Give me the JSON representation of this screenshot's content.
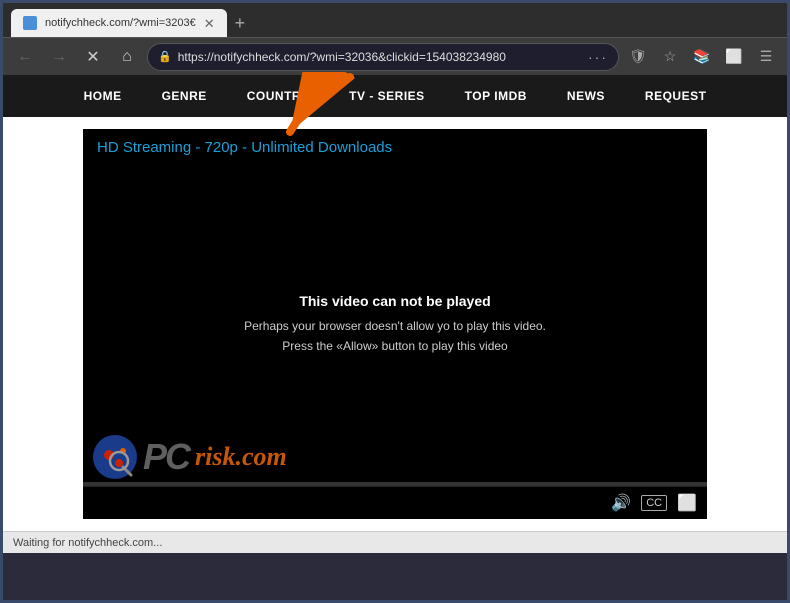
{
  "browser": {
    "tab": {
      "title": "notifychheck.com/?wmi=3203€",
      "favicon_color": "#4a90d9"
    },
    "address": "https://notifychheck.com/?wmi=32036&clickid=1540382349804",
    "address_display": "https://notifychheck.com/?wmi=32036&clickid=154038234980",
    "new_tab_label": "+",
    "back_label": "←",
    "forward_label": "→",
    "refresh_label": "✕",
    "home_label": "⌂"
  },
  "site_nav": {
    "items": [
      {
        "label": "HOME"
      },
      {
        "label": "GENRE"
      },
      {
        "label": "COUNTRY"
      },
      {
        "label": "TV - SERIES"
      },
      {
        "label": "TOP IMDB"
      },
      {
        "label": "NEWS"
      },
      {
        "label": "REQUEST"
      }
    ]
  },
  "video": {
    "title": "HD Streaming - 720p - Unlimited Downloads",
    "error_title": "This video can not be played",
    "error_line1": "Perhaps your browser doesn't allow yo to play this video.",
    "error_line2": "Press the «Allow» button to play this video"
  },
  "watermark": {
    "text": "risk.com",
    "pc_text": "PC"
  },
  "status": {
    "text": "Waiting for notifychheck.com..."
  },
  "controls": {
    "volume": "🔊",
    "cc": "CC",
    "fullscreen": "⛶"
  }
}
